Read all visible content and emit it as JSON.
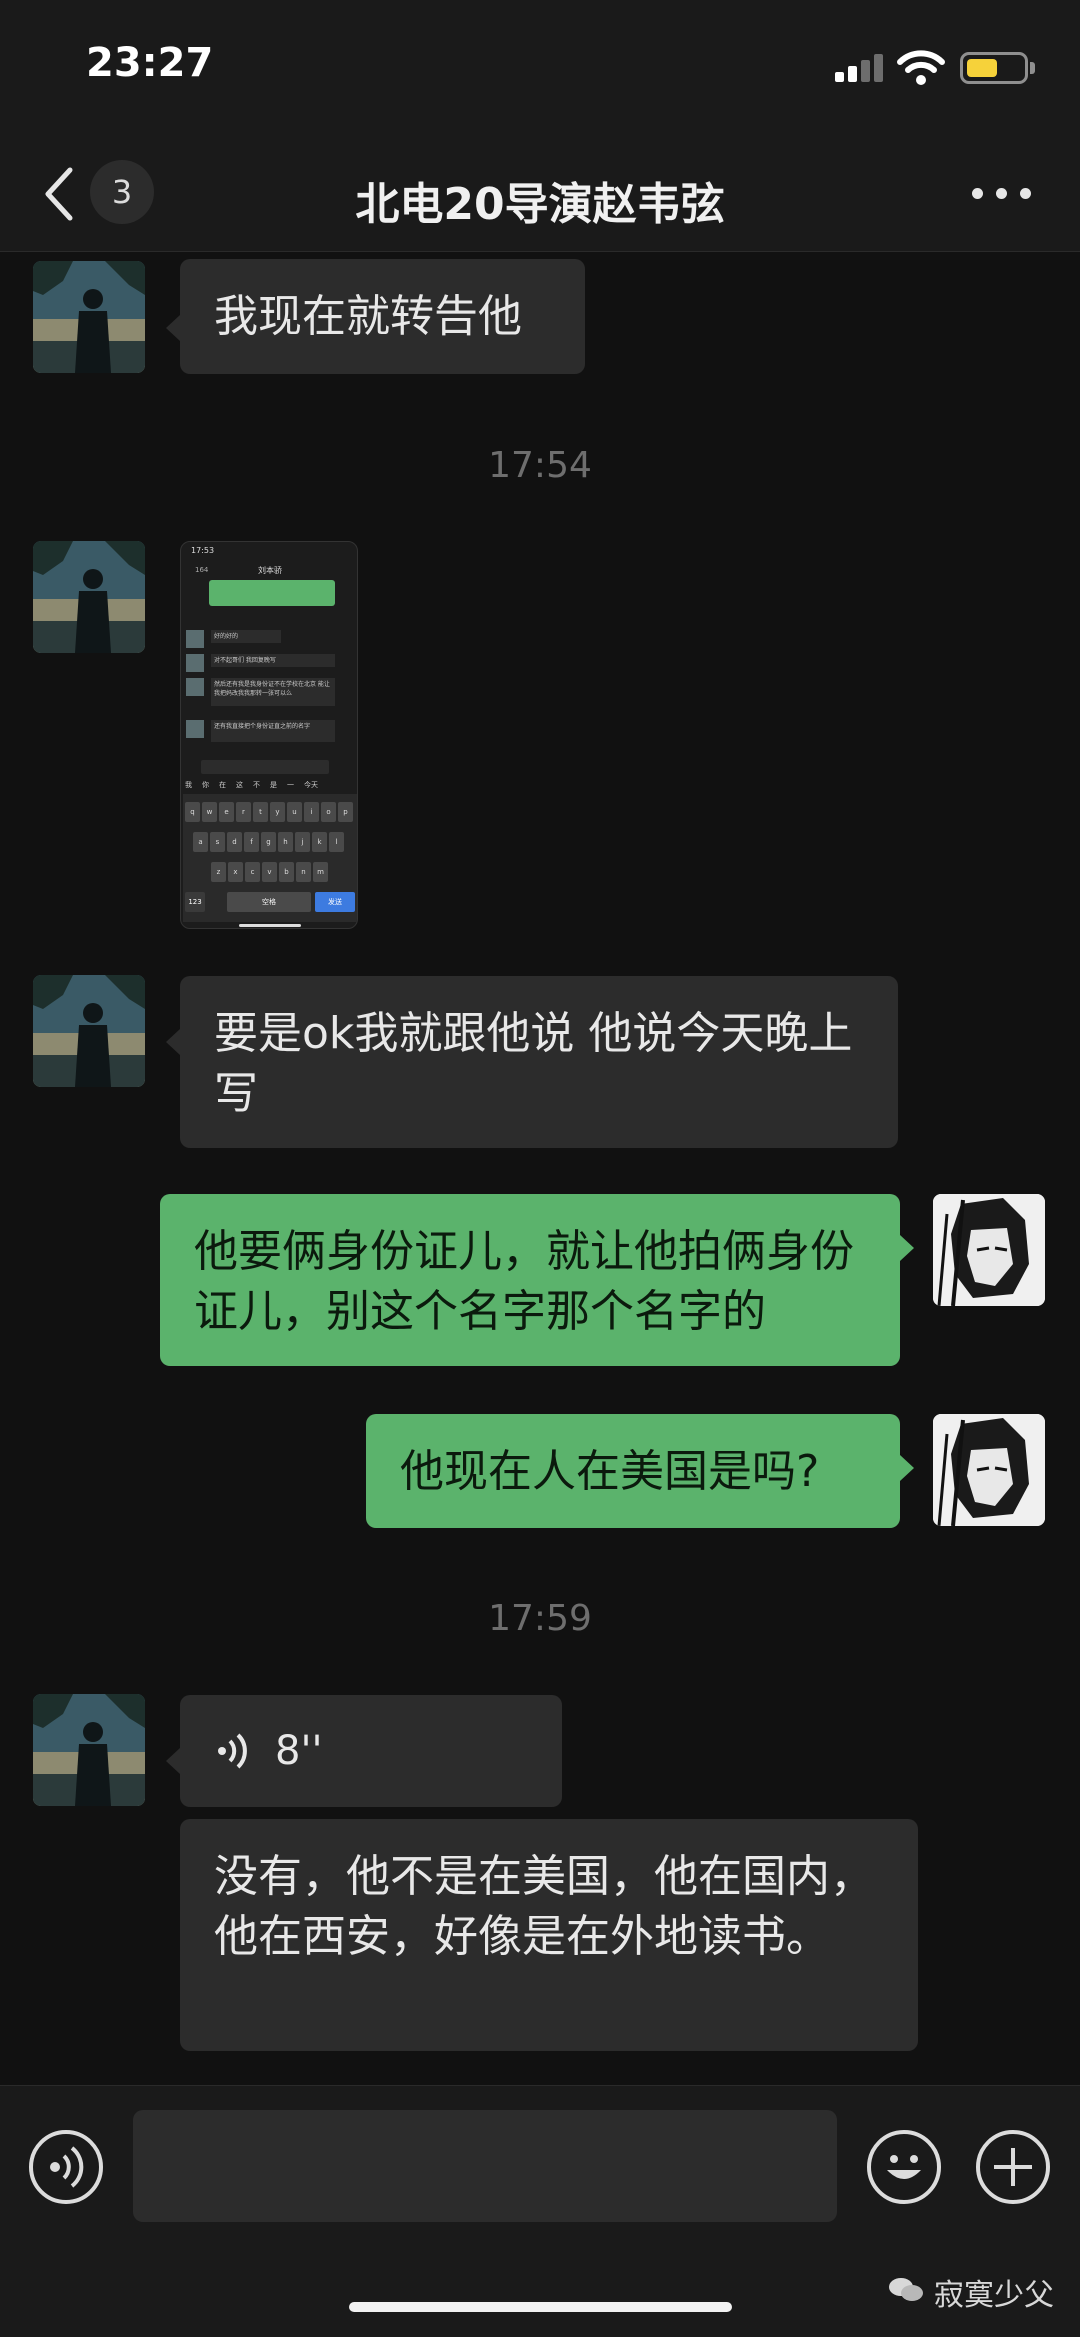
{
  "status_bar": {
    "time": "23:27"
  },
  "nav": {
    "back_count": "3",
    "title": "北电20导演赵韦弦"
  },
  "messages": [
    {
      "side": "left",
      "text": "我现在就转告他"
    },
    {
      "timestamp": "17:54"
    },
    {
      "side": "left",
      "type": "screenshot",
      "screenshot": {
        "time": "17:53",
        "back_count": "164",
        "title": "刘本骄",
        "rows": [
          "好的好的",
          "对不起哥们 我回复晚写",
          "然后还有我是我身份证不在学校在北京 能让我把妈改我我那转一张可以么",
          "还有我直接把个身份证直之前的名字"
        ],
        "candidates": [
          "我",
          "你",
          "在",
          "这",
          "不",
          "是",
          "一",
          "今天"
        ],
        "keyboard_rows": [
          [
            "q",
            "w",
            "e",
            "r",
            "t",
            "y",
            "u",
            "i",
            "o",
            "p"
          ],
          [
            "a",
            "s",
            "d",
            "f",
            "g",
            "h",
            "j",
            "k",
            "l"
          ],
          [
            "z",
            "x",
            "c",
            "v",
            "b",
            "n",
            "m"
          ]
        ],
        "space_label": "空格",
        "send_label": "发送",
        "num_label": "123"
      }
    },
    {
      "side": "left",
      "text": "要是ok我就跟他说 他说今天晚上写"
    },
    {
      "side": "right",
      "text": "他要俩身份证儿，就让他拍俩身份证儿，别这个名字那个名字的"
    },
    {
      "side": "right",
      "text": "他现在人在美国是吗?"
    },
    {
      "timestamp": "17:59"
    },
    {
      "side": "left",
      "type": "voice",
      "duration": "8''"
    },
    {
      "side": "left",
      "text": "没有，他不是在美国，他在国内，他在西安，好像是在外地读书。"
    }
  ],
  "input": {
    "placeholder": ""
  },
  "watermark": "寂寞少父",
  "icons": {
    "back": "chevron-left-icon",
    "more": "more-dots-icon",
    "voice": "voice-mode-icon",
    "emoji": "emoji-icon",
    "plus": "plus-icon",
    "voice_wave": "voice-wave-icon"
  },
  "colors": {
    "bg": "#111111",
    "bubble_left": "#2c2c2c",
    "bubble_right": "#5bb36c",
    "accent": "#5bb36c"
  }
}
